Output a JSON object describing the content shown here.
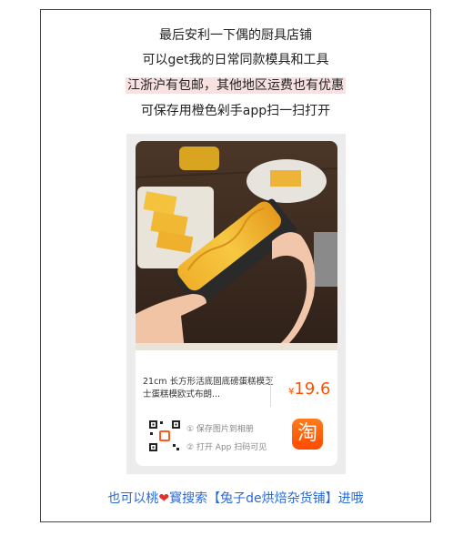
{
  "lines": [
    "最后安利一下偶的厨具店铺",
    "可以get我的日常同款模具和工具",
    "江浙沪有包邮，其他地区运费也有优惠",
    "可保存用橙色剁手app扫一扫打开"
  ],
  "card": {
    "title": "21cm 长方形活底固底磅蛋糕模芝士蛋糕模欧式布朗...",
    "currency": "¥",
    "price": "19.6",
    "step1": "① 保存图片到相册",
    "step2": "② 打开 App 扫码可见",
    "app_glyph": "淘"
  },
  "footer": {
    "before": "也可以桃",
    "heart": "❤",
    "after": "寳搜索【兔子de烘焙杂货铺】进哦"
  },
  "colors": {
    "price": "#ff5000",
    "link": "#2a6ad8",
    "highlight": "#f8e1e1"
  },
  "icons": [
    "qr-code-icon",
    "taobao-app-icon",
    "heart-icon"
  ]
}
